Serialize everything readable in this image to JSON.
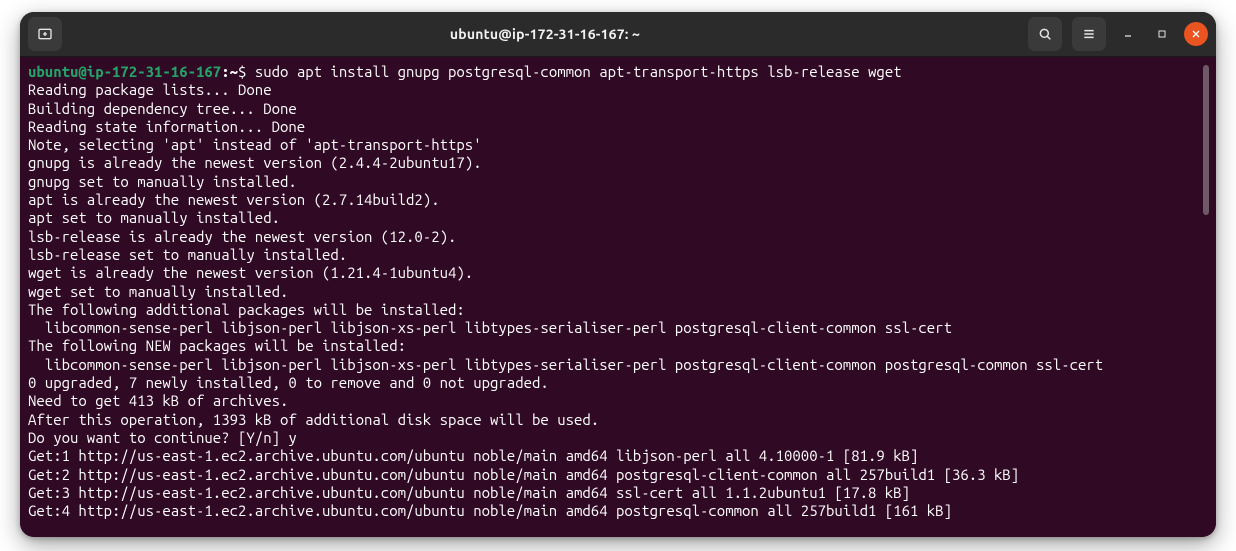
{
  "titlebar": {
    "title": "ubuntu@ip-172-31-16-167: ~"
  },
  "prompt": {
    "user_host": "ubuntu@ip-172-31-16-167",
    "sep": ":",
    "path": "~",
    "dollar": "$",
    "command": "sudo apt install gnupg postgresql-common apt-transport-https lsb-release wget"
  },
  "lines": {
    "l01": "Reading package lists... Done",
    "l02": "Building dependency tree... Done",
    "l03": "Reading state information... Done",
    "l04": "Note, selecting 'apt' instead of 'apt-transport-https'",
    "l05": "gnupg is already the newest version (2.4.4-2ubuntu17).",
    "l06": "gnupg set to manually installed.",
    "l07": "apt is already the newest version (2.7.14build2).",
    "l08": "apt set to manually installed.",
    "l09": "lsb-release is already the newest version (12.0-2).",
    "l10": "lsb-release set to manually installed.",
    "l11": "wget is already the newest version (1.21.4-1ubuntu4).",
    "l12": "wget set to manually installed.",
    "l13": "The following additional packages will be installed:",
    "l14": "  libcommon-sense-perl libjson-perl libjson-xs-perl libtypes-serialiser-perl postgresql-client-common ssl-cert",
    "l15": "The following NEW packages will be installed:",
    "l16": "  libcommon-sense-perl libjson-perl libjson-xs-perl libtypes-serialiser-perl postgresql-client-common postgresql-common ssl-cert",
    "l17": "0 upgraded, 7 newly installed, 0 to remove and 0 not upgraded.",
    "l18": "Need to get 413 kB of archives.",
    "l19": "After this operation, 1393 kB of additional disk space will be used.",
    "l20": "Do you want to continue? [Y/n] y",
    "l21": "Get:1 http://us-east-1.ec2.archive.ubuntu.com/ubuntu noble/main amd64 libjson-perl all 4.10000-1 [81.9 kB]",
    "l22": "Get:2 http://us-east-1.ec2.archive.ubuntu.com/ubuntu noble/main amd64 postgresql-client-common all 257build1 [36.3 kB]",
    "l23": "Get:3 http://us-east-1.ec2.archive.ubuntu.com/ubuntu noble/main amd64 ssl-cert all 1.1.2ubuntu1 [17.8 kB]",
    "l24": "Get:4 http://us-east-1.ec2.archive.ubuntu.com/ubuntu noble/main amd64 postgresql-common all 257build1 [161 kB]"
  }
}
